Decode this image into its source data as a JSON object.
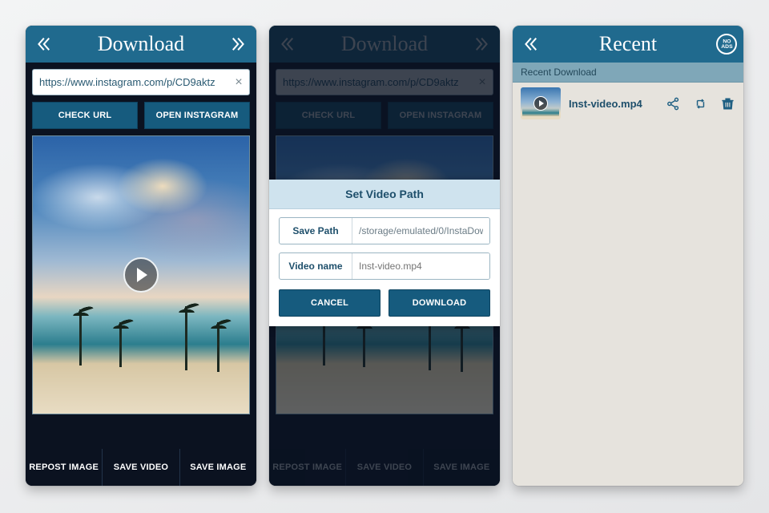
{
  "screen1": {
    "title": "Download",
    "url_value": "https://www.instagram.com/p/CD9aktz",
    "check_url": "CHECK URL",
    "open_ig": "OPEN INSTAGRAM",
    "repost": "REPOST IMAGE",
    "save_video": "SAVE VIDEO",
    "save_image": "SAVE IMAGE"
  },
  "screen2": {
    "title": "Download",
    "url_value": "https://www.instagram.com/p/CD9aktz",
    "check_url": "CHECK URL",
    "open_ig": "OPEN INSTAGRAM",
    "repost": "REPOST IMAGE",
    "save_video": "SAVE VIDEO",
    "save_image": "SAVE IMAGE",
    "dialog": {
      "title": "Set Video Path",
      "save_path_label": "Save Path",
      "save_path_value": "/storage/emulated/0/InstaDownlo",
      "video_name_label": "Video name",
      "video_name_placeholder": "Inst-video.mp4",
      "cancel": "CANCEL",
      "download": "DOWNLOAD"
    }
  },
  "screen3": {
    "title": "Recent",
    "noads": "NO ADS",
    "section": "Recent Download",
    "file": "Inst-video.mp4"
  }
}
